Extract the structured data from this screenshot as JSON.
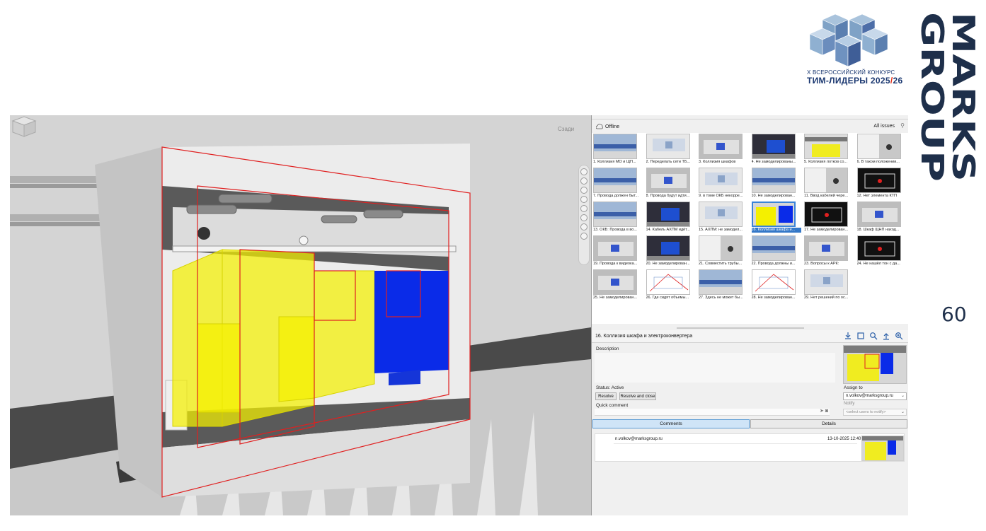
{
  "branding": {
    "contest_line1": "X ВСЕРОССИЙСКИЙ КОНКУРС",
    "contest_line2_main": "ТИМ-ЛИДЕРЫ 2025",
    "contest_line2_slash": "/",
    "contest_line2_end": "26",
    "brand_line1": "MARKS",
    "brand_line2": "GROUP",
    "page_number": "60",
    "colors": {
      "brand": "#1e2f4a",
      "accent": "#e4321b"
    }
  },
  "viewport": {
    "viewcube_label": "Сзади",
    "colors": {
      "cabinet": "#f2f000",
      "converter": "#0a2be8",
      "clash_box": "#e02020",
      "background": "#d9d9d9"
    }
  },
  "panel": {
    "status": "Offline",
    "filter": "All issues",
    "issues": [
      {
        "label": "1. Коллизия МО и ЩП...",
        "thumb": "blue-pipes"
      },
      {
        "label": "2. Переделать сети ТБ...",
        "thumb": "light-room"
      },
      {
        "label": "3. Коллизия шкафов",
        "thumb": "grey-shelf"
      },
      {
        "label": "4. Не замоделированы...",
        "thumb": "dark-blue"
      },
      {
        "label": "5. Коллизия лотков со...",
        "thumb": "yellow-tray"
      },
      {
        "label": "6. В таком положении...",
        "thumb": "white-wall"
      },
      {
        "label": "7. Провода должен быт...",
        "thumb": "blue-pipes"
      },
      {
        "label": "8. Провода будут идти...",
        "thumb": "grey-shelf"
      },
      {
        "label": "9. в томе ОКБ некорре...",
        "thumb": "light-room"
      },
      {
        "label": "10. Не замоделирован...",
        "thumb": "blue-pipes"
      },
      {
        "label": "11. Ввод кабелей чере...",
        "thumb": "white-wall"
      },
      {
        "label": "12. Нет элемента КТП",
        "thumb": "black-panel"
      },
      {
        "label": "13. ОКБ: Провода в во...",
        "thumb": "blue-pipes"
      },
      {
        "label": "14. Кабель АХПМ идёт...",
        "thumb": "dark-blue"
      },
      {
        "label": "15. АХПМ: не замодел...",
        "thumb": "light-room"
      },
      {
        "label": "16. Коллизия шкафа и...",
        "thumb": "yellow-blue",
        "selected": true
      },
      {
        "label": "17. Не замоделирован...",
        "thumb": "black-panel"
      },
      {
        "label": "18. Шкаф ЩНП наход...",
        "thumb": "grey-shelf"
      },
      {
        "label": "19. Провода к видеока...",
        "thumb": "grey-shelf"
      },
      {
        "label": "20. Не замоделирован...",
        "thumb": "dark-blue"
      },
      {
        "label": "21. Совместить трубы...",
        "thumb": "white-wall"
      },
      {
        "label": "22. Провода должны и...",
        "thumb": "blue-pipes"
      },
      {
        "label": "23. Вопросы к АРК:",
        "thumb": "grey-shelf"
      },
      {
        "label": "24. Не нашёл тон с да...",
        "thumb": "black-panel"
      },
      {
        "label": "25. Не замоделирован...",
        "thumb": "grey-shelf"
      },
      {
        "label": "26. Где сидят объемы...",
        "thumb": "drawing"
      },
      {
        "label": "27. Здесь не может бы...",
        "thumb": "blue-pipes"
      },
      {
        "label": "28. Не замоделирован...",
        "thumb": "drawing"
      },
      {
        "label": "29. Нет решений по ос...",
        "thumb": "light-room"
      }
    ],
    "issue": {
      "title": "16. Коллизия шкафа и электроконвертера",
      "description_label": "Description",
      "status": "Status: Active",
      "resolve": "Resolve",
      "resolve_close": "Resolve and close",
      "assign_label": "Assign to",
      "assignee": "n.volkov@marksgroup.ru",
      "quick_comment_label": "Quick comment",
      "notify_label": "Notify",
      "notify_placeholder": "<select users to notify>"
    },
    "tabs": {
      "comments": "Comments",
      "details": "Details"
    },
    "comment": {
      "author": "n.volkov@marksgroup.ru",
      "time": "13-10-2025 12:40"
    }
  }
}
